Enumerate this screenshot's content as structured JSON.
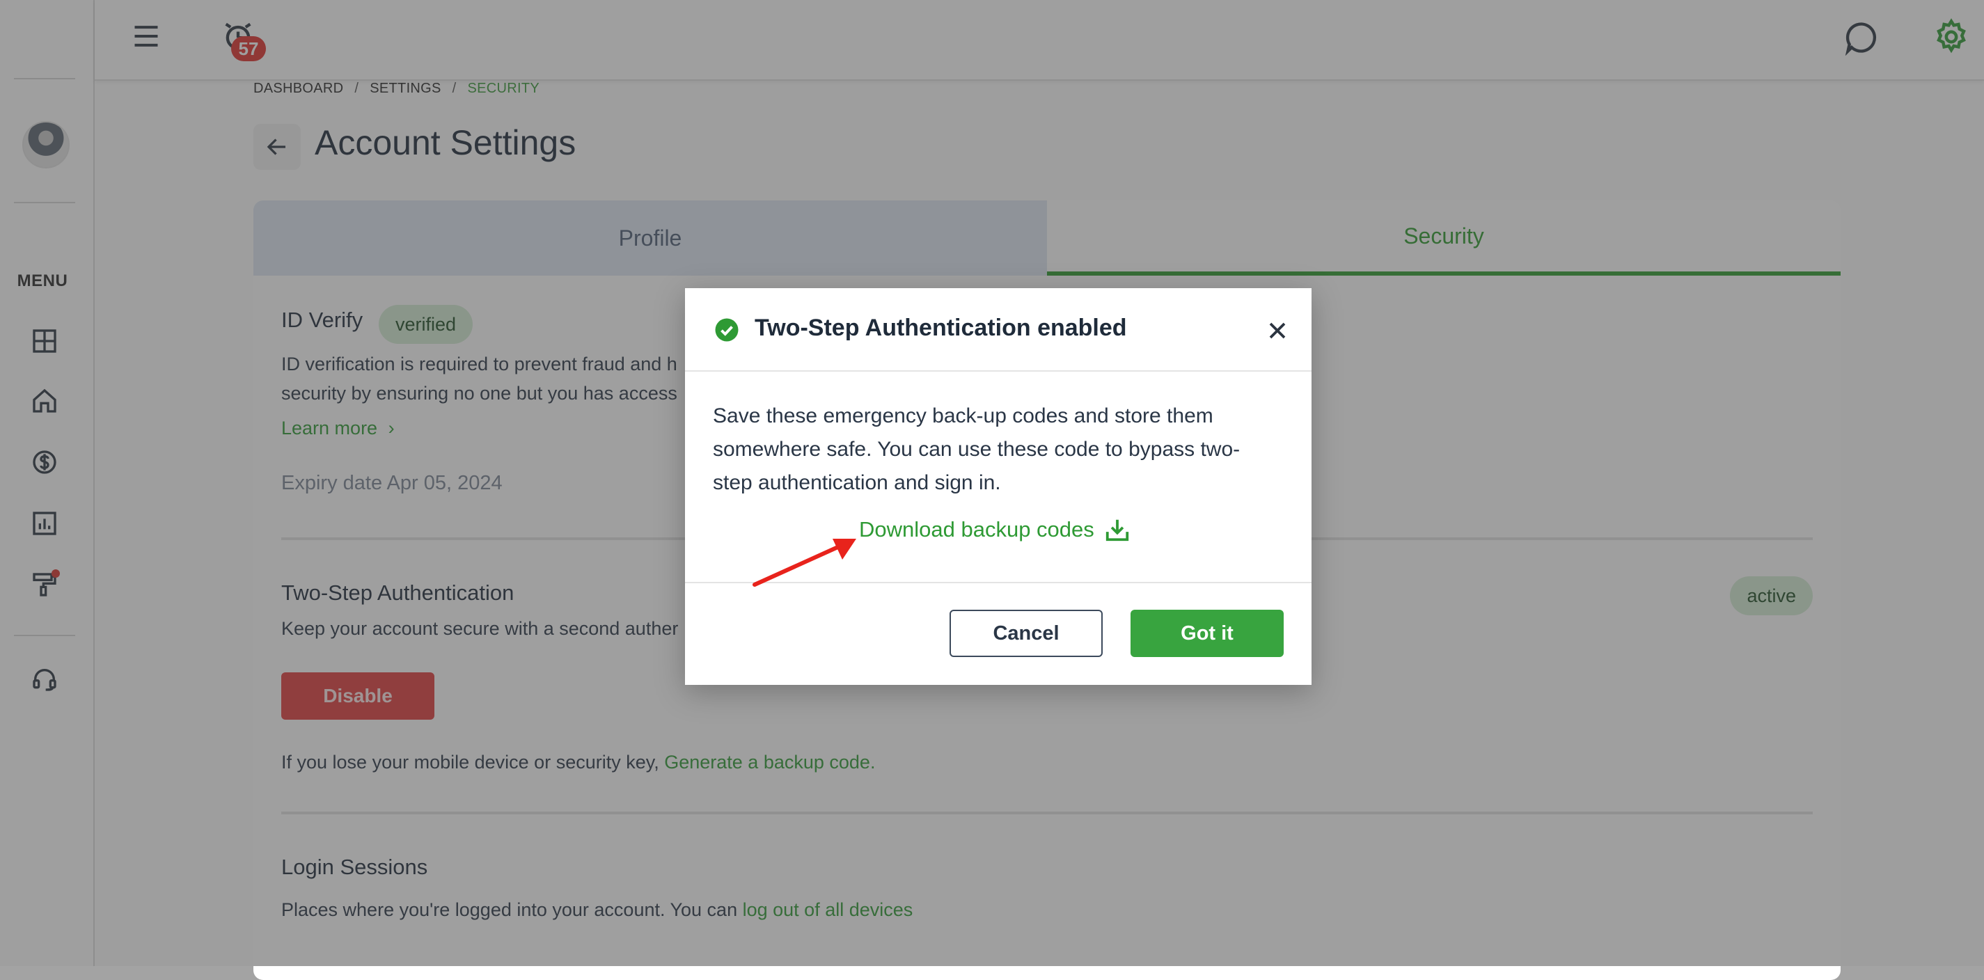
{
  "header": {
    "notification_count": "57"
  },
  "sidebar": {
    "menu_label": "MENU",
    "items": [
      {
        "icon": "dashboard-grid-icon"
      },
      {
        "icon": "home-icon"
      },
      {
        "icon": "dollar-icon"
      },
      {
        "icon": "chart-icon"
      },
      {
        "icon": "paint-roller-icon"
      },
      {
        "icon": "headset-icon"
      }
    ]
  },
  "breadcrumb": {
    "items": [
      "DASHBOARD",
      "SETTINGS",
      "SECURITY"
    ]
  },
  "page": {
    "title": "Account Settings"
  },
  "tabs": {
    "profile": "Profile",
    "security": "Security"
  },
  "id_verify": {
    "title": "ID Verify",
    "badge": "verified",
    "desc_line1": "ID verification is required to prevent fraud and h",
    "desc_line2": "security by ensuring no one but you has access",
    "learn_more": "Learn more",
    "expiry": "Expiry date Apr 05, 2024"
  },
  "two_step": {
    "title": "Two-Step Authentication",
    "badge": "active",
    "desc": "Keep your account secure with a second auther",
    "disable_label": "Disable",
    "backup_prefix": "If you lose your mobile device or security key, ",
    "backup_link": "Generate a backup code."
  },
  "login_sessions": {
    "title": "Login Sessions",
    "desc_prefix": "Places where you're logged into your account. You can ",
    "logout_link": "log out of all devices"
  },
  "modal": {
    "title": "Two-Step Authentication enabled",
    "body": "Save these emergency back-up codes and store them somewhere safe. You can use these code to bypass two-step authentication and sign in.",
    "download_label": "Download backup codes",
    "cancel_label": "Cancel",
    "confirm_label": "Got it"
  },
  "colors": {
    "accent": "#2e9a34",
    "danger": "#e03d3d",
    "badge": "#e0302c"
  }
}
